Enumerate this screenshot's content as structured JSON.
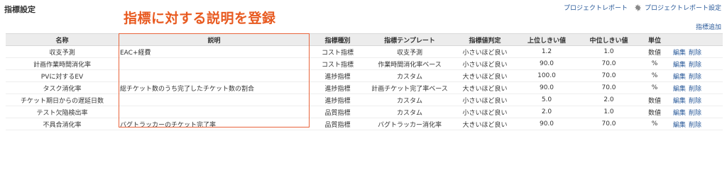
{
  "page": {
    "title": "指標設定"
  },
  "annotation": "指標に対する説明を登録",
  "top_links": {
    "report": "プロジェクトレポート",
    "settings": "プロジェクトレポート設定"
  },
  "add_link": "指標追加",
  "table": {
    "headers": [
      "名称",
      "説明",
      "指標種別",
      "指標テンプレート",
      "指標値判定",
      "上位しきい値",
      "中位しきい値",
      "単位",
      ""
    ],
    "edit_label": "編集",
    "delete_label": "削除",
    "rows": [
      {
        "name": "収支予測",
        "desc": "EAC+経費",
        "kind": "コスト指標",
        "template": "収支予測",
        "judge": "小さいほど良い",
        "upper": "1.2",
        "middle": "1.0",
        "unit": "数値"
      },
      {
        "name": "計画作業時間消化率",
        "desc": "",
        "kind": "コスト指標",
        "template": "作業時間消化率ベース",
        "judge": "小さいほど良い",
        "upper": "90.0",
        "middle": "70.0",
        "unit": "%"
      },
      {
        "name": "PVに対するEV",
        "desc": "",
        "kind": "進捗指標",
        "template": "カスタム",
        "judge": "大きいほど良い",
        "upper": "100.0",
        "middle": "70.0",
        "unit": "%"
      },
      {
        "name": "タスク消化率",
        "desc": "総チケット数のうち完了したチケット数の割合",
        "kind": "進捗指標",
        "template": "計画チケット完了率ベース",
        "judge": "大きいほど良い",
        "upper": "90.0",
        "middle": "70.0",
        "unit": "%"
      },
      {
        "name": "チケット期日からの遅延日数",
        "desc": "",
        "kind": "進捗指標",
        "template": "カスタム",
        "judge": "小さいほど良い",
        "upper": "5.0",
        "middle": "2.0",
        "unit": "数値"
      },
      {
        "name": "テスト欠陥検出率",
        "desc": "",
        "kind": "品質指標",
        "template": "カスタム",
        "judge": "小さいほど良い",
        "upper": "2.0",
        "middle": "1.0",
        "unit": "数値"
      },
      {
        "name": "不具合消化率",
        "desc": "バグトラッカーのチケット完了率",
        "kind": "品質指標",
        "template": "バグトラッカー消化率",
        "judge": "大きいほど良い",
        "upper": "90.0",
        "middle": "70.0",
        "unit": "%"
      }
    ]
  },
  "colors": {
    "accent": "#e8643c",
    "link": "#2a5a9a",
    "header_bg": "#ececec"
  },
  "icons": {
    "settings": "gear-icon"
  }
}
